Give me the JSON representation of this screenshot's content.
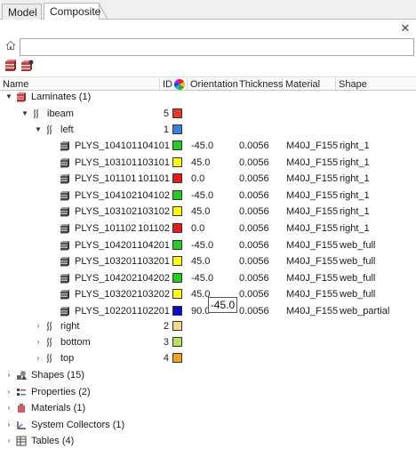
{
  "tabs": [
    {
      "label": "Model"
    },
    {
      "label": "Composite"
    }
  ],
  "search": {
    "value": "",
    "placeholder": ""
  },
  "columns": {
    "name": "Name",
    "id": "ID",
    "orientation": "Orientation",
    "thickness": "Thickness",
    "material": "Material",
    "shape": "Shape"
  },
  "tree": {
    "laminates": {
      "label": "Laminates (1)",
      "expanded": true
    },
    "ibeam": {
      "label": "ibeam",
      "id": "5",
      "color": "#e8382a",
      "expanded": true
    },
    "left": {
      "label": "left",
      "id": "1",
      "color": "#3a7ee6",
      "expanded": true
    },
    "plies": [
      {
        "name": "PLYS_104101",
        "id": "104101",
        "color": "#22cc22",
        "orientation": "-45.0",
        "thickness": "0.0056",
        "material": "M40J_F155",
        "shape": "right_1"
      },
      {
        "name": "PLYS_103101",
        "id": "103101",
        "color": "#ffff00",
        "orientation": "45.0",
        "thickness": "0.0056",
        "material": "M40J_F155",
        "shape": "right_1"
      },
      {
        "name": "PLYS_101101",
        "id": "101101",
        "color": "#e81818",
        "orientation": "0.0",
        "thickness": "0.0056",
        "material": "M40J_F155",
        "shape": "right_1"
      },
      {
        "name": "PLYS_104102",
        "id": "104102",
        "color": "#22cc22",
        "orientation": "-45.0",
        "thickness": "0.0056",
        "material": "M40J_F155",
        "shape": "right_1"
      },
      {
        "name": "PLYS_103102",
        "id": "103102",
        "color": "#ffff00",
        "orientation": "45.0",
        "thickness": "0.0056",
        "material": "M40J_F155",
        "shape": "right_1"
      },
      {
        "name": "PLYS_101102",
        "id": "101102",
        "color": "#e81818",
        "orientation": "0.0",
        "thickness": "0.0056",
        "material": "M40J_F155",
        "shape": "right_1"
      },
      {
        "name": "PLYS_104201",
        "id": "104201",
        "color": "#22cc22",
        "orientation": "-45.0",
        "thickness": "0.0056",
        "material": "M40J_F155",
        "shape": "web_full"
      },
      {
        "name": "PLYS_103201",
        "id": "103201",
        "color": "#ffff00",
        "orientation": "45.0",
        "thickness": "0.0056",
        "material": "M40J_F155",
        "shape": "web_full"
      },
      {
        "name": "PLYS_104202",
        "id": "104202",
        "color": "#22cc22",
        "orientation": "-45.0",
        "thickness": "0.0056",
        "material": "M40J_F155",
        "shape": "web_full"
      },
      {
        "name": "PLYS_103202",
        "id": "103202",
        "color": "#ffff00",
        "orientation": "45.0",
        "thickness": "0.0056",
        "material": "M40J_F155",
        "shape": "web_full"
      },
      {
        "name": "PLYS_102201",
        "id": "102201",
        "color": "#0a0ad0",
        "orientation": "90.0",
        "thickness": "0.0056",
        "material": "M40J_F155",
        "shape": "web_partial"
      }
    ],
    "right": {
      "label": "right",
      "id": "2",
      "color": "#f6d88a"
    },
    "bottom": {
      "label": "bottom",
      "id": "3",
      "color": "#bde05a"
    },
    "top": {
      "label": "top",
      "id": "4",
      "color": "#f4a21c"
    },
    "categories": [
      {
        "label": "Shapes (15)",
        "icon": "shapes-icon"
      },
      {
        "label": "Properties (2)",
        "icon": "properties-icon"
      },
      {
        "label": "Materials (1)",
        "icon": "materials-icon"
      },
      {
        "label": "System Collectors (1)",
        "icon": "system-collectors-icon"
      },
      {
        "label": "Tables (4)",
        "icon": "tables-icon"
      }
    ]
  },
  "tooltip": {
    "text": "-45.0"
  }
}
